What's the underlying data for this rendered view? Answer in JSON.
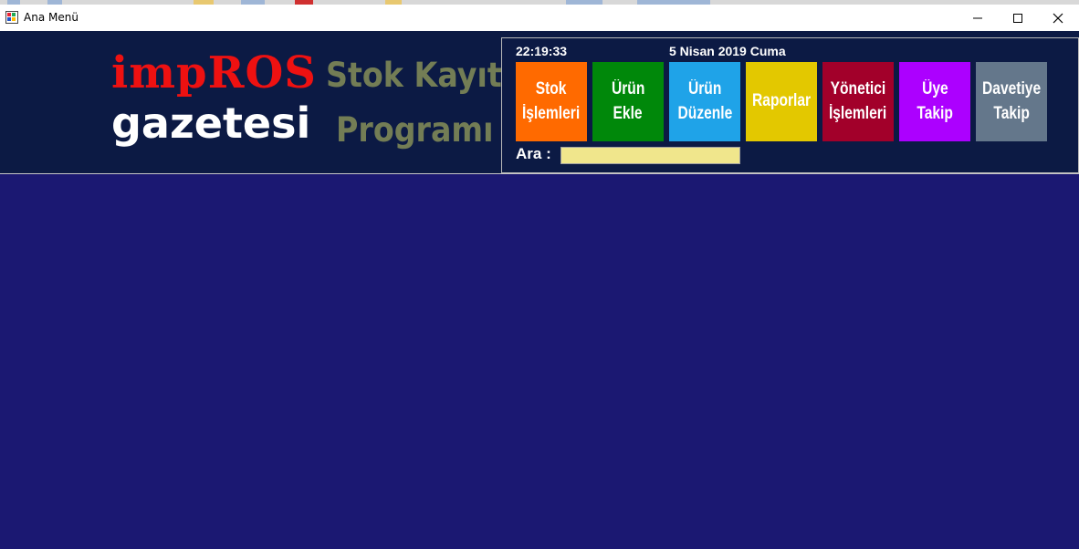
{
  "window": {
    "title": "Ana Menü",
    "controls": {
      "minimize": "minimize-icon",
      "maximize": "maximize-icon",
      "close": "close-icon"
    }
  },
  "background_colors": {
    "body": "#1b1872",
    "header": "#0c1a44"
  },
  "branding": {
    "logo_line1": "impROS",
    "logo_line2": "gazetesi",
    "program_line1": "Stok Kayıt",
    "program_line2": "Programı"
  },
  "status": {
    "time": "22:19:33",
    "date": "5 Nisan 2019 Cuma"
  },
  "tiles": [
    {
      "line1": "Stok",
      "line2": "İşlemleri",
      "color": "#ff6a00"
    },
    {
      "line1": "Ürün",
      "line2": "Ekle",
      "color": "#00880a"
    },
    {
      "line1": "Ürün",
      "line2": "Düzenle",
      "color": "#1fa3e8"
    },
    {
      "line1": "Raporlar",
      "line2": "",
      "color": "#e3c800"
    },
    {
      "line1": "Yönetici",
      "line2": "İşlemleri",
      "color": "#a2002a"
    },
    {
      "line1": "Üye",
      "line2": "Takip",
      "color": "#ac00ff"
    },
    {
      "line1": "Davetiye",
      "line2": "Takip",
      "color": "#64778b"
    }
  ],
  "search": {
    "label": "Ara :",
    "value": ""
  }
}
